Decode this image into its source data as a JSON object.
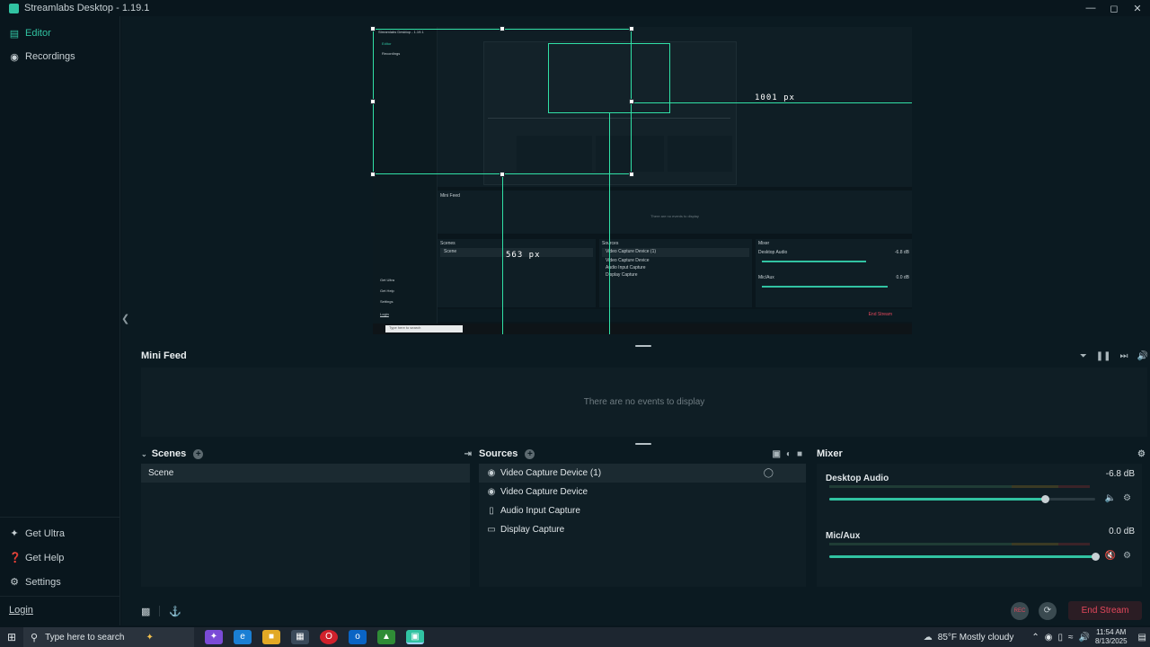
{
  "window": {
    "title": "Streamlabs Desktop - 1.19.1"
  },
  "sidebar": {
    "top_items": [
      {
        "label": "Editor"
      },
      {
        "label": "Recordings"
      }
    ],
    "bottom_items": [
      {
        "label": "Get Ultra"
      },
      {
        "label": "Get Help"
      },
      {
        "label": "Settings"
      }
    ],
    "login_label": "Login"
  },
  "preview": {
    "width_label": "1001 px",
    "height_label": "563 px",
    "nested_title": "Streamlabs Desktop - 1.19.1",
    "nested_nav": [
      "Editor",
      "Recordings"
    ],
    "nested_feed_title": "Mini Feed",
    "nested_feed_empty": "There are no events to display",
    "nested_scenes_title": "Scenes",
    "nested_scene": "Scene",
    "nested_sources_title": "Sources",
    "nested_sources": [
      "Video Capture Device (1)",
      "Video Capture Device",
      "Audio Input Capture",
      "Display Capture"
    ],
    "nested_mixer_title": "Mixer",
    "nested_mixer": [
      {
        "name": "Desktop Audio",
        "db": "-6.8 dB"
      },
      {
        "name": "Mic/Aux",
        "db": "0.0 dB"
      }
    ],
    "nested_end": "End Stream",
    "nested_search": "Type here to search",
    "nested_bottom_nav": [
      "Get Ultra",
      "Get Help",
      "Settings",
      "Login"
    ]
  },
  "minifeed": {
    "title": "Mini Feed",
    "empty_text": "There are no events to display"
  },
  "scenes": {
    "title": "Scenes",
    "items": [
      "Scene"
    ]
  },
  "sources": {
    "title": "Sources",
    "items": [
      {
        "label": "Video Capture Device (1)",
        "icon": "webcam-icon"
      },
      {
        "label": "Video Capture Device",
        "icon": "webcam-icon"
      },
      {
        "label": "Audio Input Capture",
        "icon": "microphone-icon"
      },
      {
        "label": "Display Capture",
        "icon": "monitor-icon"
      }
    ]
  },
  "mixer": {
    "title": "Mixer",
    "items": [
      {
        "name": "Desktop Audio",
        "db": "-6.8 dB",
        "level": 0.81
      },
      {
        "name": "Mic/Aux",
        "db": "0.0 dB",
        "level": 1.0
      }
    ]
  },
  "controls": {
    "rec_label": "REC",
    "end_stream_label": "End Stream"
  },
  "taskbar": {
    "search_placeholder": "Type here to search",
    "weather": "85°F  Mostly cloudy",
    "time": "11:54 AM",
    "date": "8/13/2025"
  },
  "colors": {
    "accent": "#31c3a2",
    "guide": "#31e0a6",
    "danger": "#e4485c",
    "background": "#09161d",
    "panel": "#0f1e25"
  }
}
